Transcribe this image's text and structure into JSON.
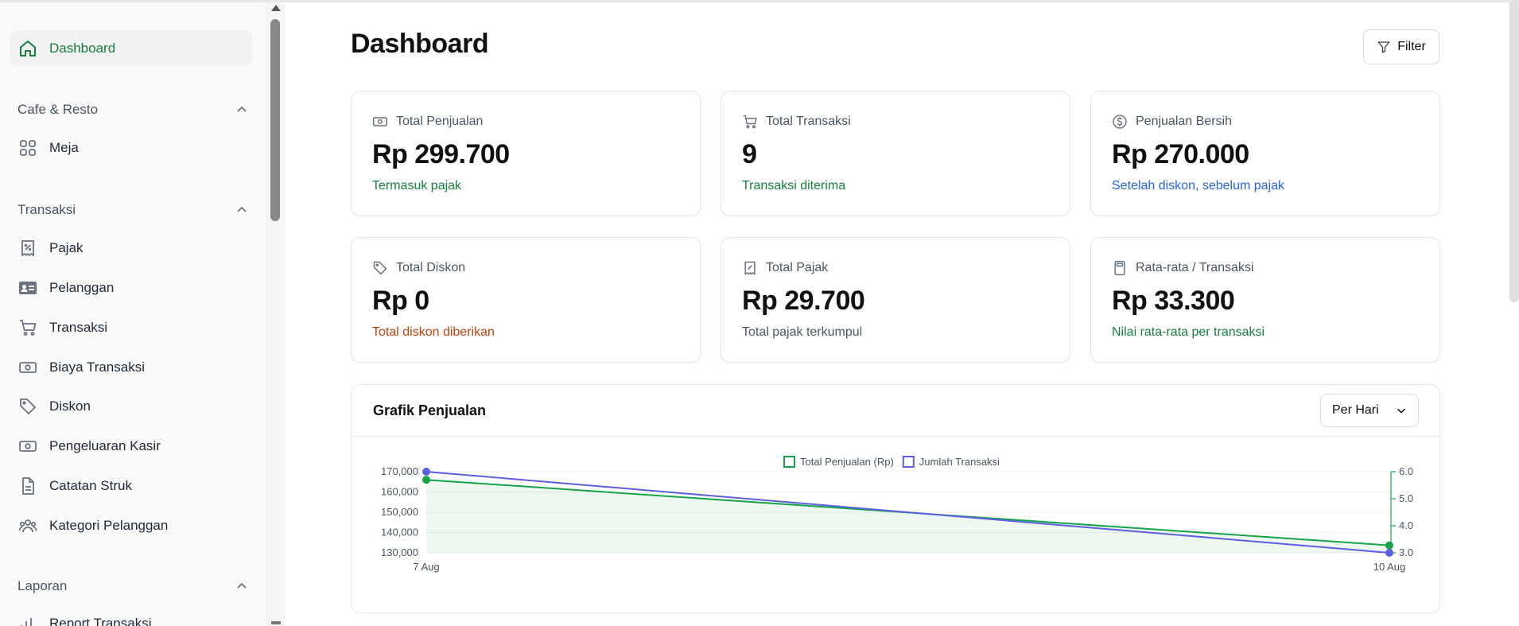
{
  "sidebar": {
    "active_item": {
      "label": "Dashboard",
      "icon": "home-icon"
    },
    "sections": [
      {
        "label": "Cafe & Resto",
        "items": [
          {
            "label": "Meja",
            "icon": "grid-icon"
          }
        ]
      },
      {
        "label": "Transaksi",
        "items": [
          {
            "label": "Pajak",
            "icon": "receipt-percent-icon"
          },
          {
            "label": "Pelanggan",
            "icon": "id-card-icon"
          },
          {
            "label": "Transaksi",
            "icon": "cart-icon"
          },
          {
            "label": "Biaya Transaksi",
            "icon": "banknote-icon"
          },
          {
            "label": "Diskon",
            "icon": "tag-icon"
          },
          {
            "label": "Pengeluaran Kasir",
            "icon": "banknote-icon"
          },
          {
            "label": "Catatan Struk",
            "icon": "file-text-icon"
          },
          {
            "label": "Kategori Pelanggan",
            "icon": "users-icon"
          }
        ]
      },
      {
        "label": "Laporan",
        "items": [
          {
            "label": "Report Transaksi",
            "icon": "bar-chart-icon"
          }
        ]
      }
    ]
  },
  "header": {
    "title": "Dashboard",
    "filter_label": "Filter"
  },
  "stats": [
    {
      "label": "Total Penjualan",
      "value": "Rp 299.700",
      "sub": "Termasuk pajak",
      "icon": "banknote-icon",
      "sub_color": "#15803d"
    },
    {
      "label": "Total Transaksi",
      "value": "9",
      "sub": "Transaksi diterima",
      "icon": "cart-icon",
      "sub_color": "#15803d"
    },
    {
      "label": "Penjualan Bersih",
      "value": "Rp 270.000",
      "sub": "Setelah diskon, sebelum pajak",
      "icon": "dollar-circle-icon",
      "sub_color": "#2563eb"
    },
    {
      "label": "Total Diskon",
      "value": "Rp 0",
      "sub": "Total diskon diberikan",
      "icon": "tag-icon",
      "sub_color": "#c2410c"
    },
    {
      "label": "Total Pajak",
      "value": "Rp 29.700",
      "sub": "Total pajak terkumpul",
      "icon": "receipt-percent-icon",
      "sub_color": "#4b5563"
    },
    {
      "label": "Rata-rata / Transaksi",
      "value": "Rp 33.300",
      "sub": "Nilai rata-rata per transaksi",
      "icon": "calculator-icon",
      "sub_color": "#15803d"
    }
  ],
  "chart_panel": {
    "title": "Grafik Penjualan",
    "period": "Per Hari"
  },
  "chart_data": {
    "type": "line",
    "x": [
      "7 Aug",
      "10 Aug"
    ],
    "series": [
      {
        "name": "Total Penjualan (Rp)",
        "values": [
          166000,
          133700
        ],
        "axis": "left",
        "color": "#16a34a",
        "fill": true
      },
      {
        "name": "Jumlah Transaksi",
        "values": [
          6,
          3
        ],
        "axis": "right",
        "color": "#5b5fe0",
        "fill": false
      }
    ],
    "y_left": {
      "ticks": [
        "170,000",
        "160,000",
        "150,000",
        "140,000",
        "130,000"
      ],
      "range": [
        130000,
        170000
      ]
    },
    "y_right": {
      "ticks": [
        "6.0",
        "5.0",
        "4.0",
        "3.0"
      ],
      "range": [
        3,
        6
      ]
    },
    "grid": true,
    "legend": "top-center"
  }
}
